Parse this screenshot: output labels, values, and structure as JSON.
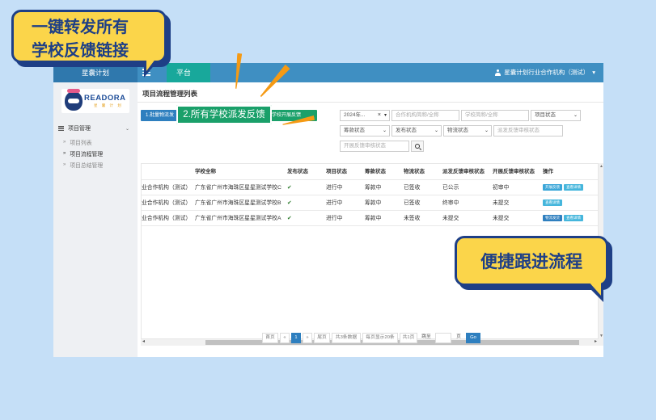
{
  "promo": {
    "top_line1": "一键转发所有",
    "top_line2": "学校反馈链接",
    "bottom": "便捷跟进流程",
    "step_label": "2.所有学校派发反馈"
  },
  "topbar": {
    "brand": "星囊计划",
    "platform": "平台",
    "user": "星囊计划行业合作机构（测试）"
  },
  "sidebar": {
    "logo_text": "READORA",
    "logo_sub": "星 囊 计 划",
    "group": "项目管理",
    "items": [
      {
        "label": "项目列表"
      },
      {
        "label": "项目流程管理"
      },
      {
        "label": "项目总结管理"
      }
    ]
  },
  "content": {
    "title": "项目流程管理列表",
    "buttons": [
      {
        "label": "1.批量物流发"
      },
      {
        "label": "与学校开展反馈"
      }
    ],
    "filters": {
      "date": "2024年...",
      "org_placeholder": "合作机构简称/全称",
      "school_placeholder": "学校简称/全称",
      "project_status": "项目状态",
      "fund_status": "筹款状态",
      "publish_status": "发布状态",
      "logistics_status": "物流状态",
      "dispatch_placeholder": "派发反馈审核状态",
      "open_placeholder": "开展反馈审核状态"
    }
  },
  "table": {
    "headers": [
      "",
      "学校全称",
      "发布状态",
      "项目状态",
      "筹款状态",
      "物流状态",
      "派发反馈审核状态",
      "开展反馈审核状态",
      "操作"
    ],
    "rows": [
      {
        "org": "业合作机构（测试）",
        "school": "广东省广州市海珠区星星测试学校C",
        "publish": "✔",
        "project": "进行中",
        "fund": "筹款中",
        "logistics": "已签收",
        "dispatch": "已公示",
        "open": "初审中",
        "actions": [
          "开展反馈",
          "查看详情"
        ]
      },
      {
        "org": "业合作机构（测试）",
        "school": "广东省广州市海珠区星星测试学校B",
        "publish": "✔",
        "project": "进行中",
        "fund": "筹款中",
        "logistics": "已签收",
        "dispatch": "终审中",
        "open": "未提交",
        "actions": [
          "查看详情"
        ]
      },
      {
        "org": "业合作机构（测试）",
        "school": "广东省广州市海珠区星星测试学校A",
        "publish": "✔",
        "project": "进行中",
        "fund": "筹款中",
        "logistics": "未签收",
        "dispatch": "未提交",
        "open": "未提交",
        "actions": [
          "物流发货",
          "查看详情"
        ]
      }
    ]
  },
  "pagination": {
    "first": "首页",
    "prev": "«",
    "current": "1",
    "next": "»",
    "last": "尾页",
    "total": "共3条数据",
    "per_page": "每页显示20条",
    "pages": "共1页",
    "jump": "跳至",
    "page_unit": "页",
    "go": "Go"
  },
  "colors": {
    "topbar": "#3f8fc2",
    "teal": "#18a89b",
    "bubble": "#fbd54a",
    "bubble_border": "#1e3f86",
    "green_label": "#1aa06a",
    "ray": "#f59a14"
  }
}
